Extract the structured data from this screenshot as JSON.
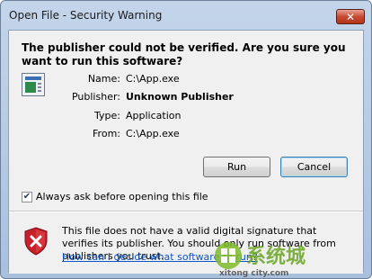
{
  "window": {
    "title": "Open File - Security Warning",
    "close_label": "✕"
  },
  "headline": "The publisher could not be verified.  Are you sure you want to run this software?",
  "fields": [
    {
      "label": "Name:",
      "value": "C:\\App.exe"
    },
    {
      "label": "Publisher:",
      "value": "Unknown Publisher"
    },
    {
      "label": "Type:",
      "value": "Application"
    },
    {
      "label": "From:",
      "value": "C:\\App.exe"
    }
  ],
  "buttons": {
    "run": "Run",
    "cancel": "Cancel"
  },
  "checkbox": {
    "label": "Always ask before opening this file",
    "checked": true,
    "mark": "✔"
  },
  "warning": {
    "text": "This file does not have a valid digital signature that verifies its publisher.  You should only run software from publishers you trust.",
    "help_link": "How can I decide what software to run?"
  },
  "watermark": {
    "text": "系统城",
    "sub": "xitong city.com"
  },
  "colors": {
    "titlebar": "#b8cde6",
    "client": "#f0f0f0",
    "link": "#0b56c9",
    "close": "#c84a33",
    "shield": "#c8202a"
  }
}
